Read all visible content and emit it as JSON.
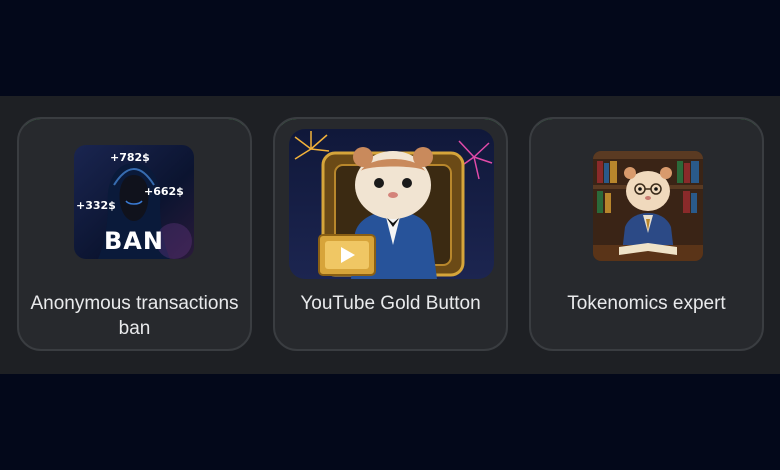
{
  "cards": [
    {
      "title": "Anonymous transactions ban",
      "image": {
        "icon": "hacker-ban-icon",
        "label": "BAN",
        "amounts": [
          "+782$",
          "+662$",
          "+332$"
        ]
      }
    },
    {
      "title": "YouTube Gold Button",
      "image": {
        "icon": "hamster-gold-play-button-icon"
      }
    },
    {
      "title": "Tokenomics expert",
      "image": {
        "icon": "hamster-professor-icon"
      }
    }
  ],
  "colors": {
    "page_background": "#03081a",
    "band_background": "#1e2024",
    "card_background": "#27292d",
    "card_highlight_border": "#4bbf5a",
    "text": "#e9eaec"
  }
}
